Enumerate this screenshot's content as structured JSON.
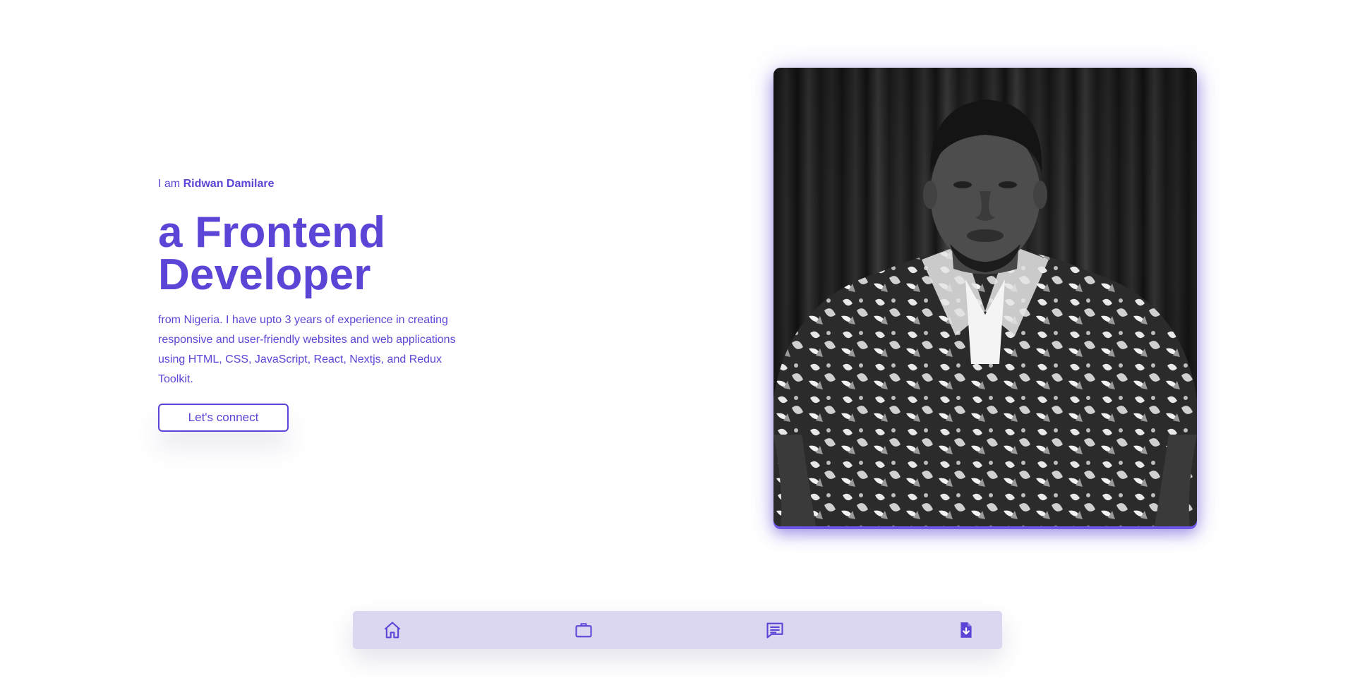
{
  "hero": {
    "intro_prefix": "I am",
    "name": "Ridwan Damilare",
    "headline_line1": "a Frontend",
    "headline_line2": "Developer",
    "bio": "from Nigeria. I have upto 3 years of experience in creating responsive and user-friendly websites and web applications using HTML, CSS, JavaScript, React, Nextjs, and Redux Toolkit.",
    "cta_label": "Let's connect"
  },
  "portrait": {
    "alt": "Portrait photo"
  },
  "bottom_nav": {
    "items": [
      {
        "icon": "home-icon"
      },
      {
        "icon": "briefcase-icon"
      },
      {
        "icon": "message-icon"
      },
      {
        "icon": "download-document-icon"
      }
    ]
  },
  "colors": {
    "accent": "#5b45d6",
    "nav_bg": "#dcd7f1",
    "page_bg": "#ffffff"
  }
}
